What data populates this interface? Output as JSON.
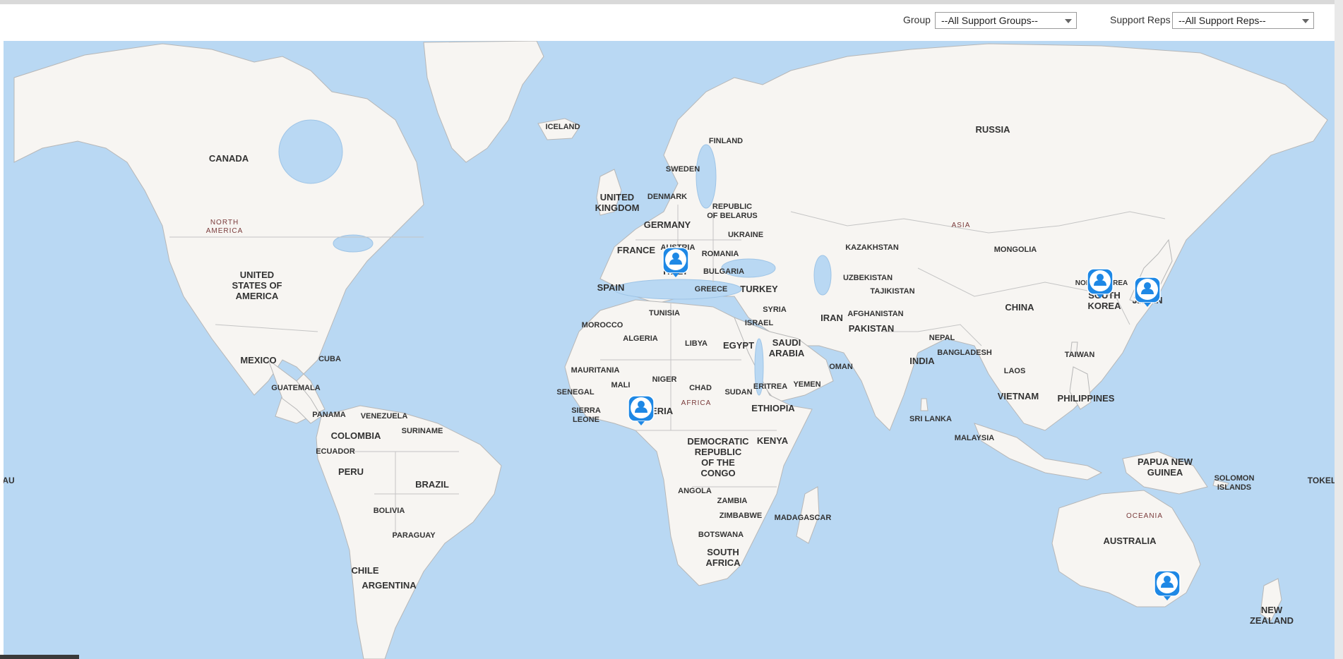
{
  "filters": {
    "group_label": "Group",
    "group_value": "--All Support Groups--",
    "reps_label": "Support Reps",
    "reps_value": "--All Support Reps--"
  },
  "map": {
    "ocean_color": "#b9d8f3",
    "land_color": "#f7f5f2",
    "border_color": "#b7b7b7",
    "marker_color": "#1e88e5",
    "marker_icon": "person-icon",
    "continent_labels": {
      "north_america": [
        "NORTH",
        "AMERICA"
      ],
      "africa": "AFRICA",
      "asia": "ASIA",
      "oceania": "OCEANIA"
    },
    "country_labels": {
      "canada": "CANADA",
      "usa": [
        "UNITED",
        "STATES OF",
        "AMERICA"
      ],
      "mexico": "MEXICO",
      "cuba": "CUBA",
      "guatemala": "GUATEMALA",
      "panama": "PANAMA",
      "venezuela": "VENEZUELA",
      "suriname": "SURINAME",
      "colombia": "COLOMBIA",
      "ecuador": "ECUADOR",
      "peru": "PERU",
      "brazil": "BRAZIL",
      "bolivia": "BOLIVIA",
      "paraguay": "PARAGUAY",
      "chile": "CHILE",
      "argentina": "ARGENTINA",
      "iceland": "ICELAND",
      "uk": [
        "UNITED",
        "KINGDOM"
      ],
      "sweden": "SWEDEN",
      "finland": "FINLAND",
      "denmark": "DENMARK",
      "belarus": [
        "REPUBLIC",
        "OF BELARUS"
      ],
      "germany": "GERMANY",
      "austria": "AUSTRIA",
      "ukraine": "UKRAINE",
      "france": "FRANCE",
      "romania": "ROMANIA",
      "bulgaria": "BULGARIA",
      "italy": "ITALY",
      "spain": "SPAIN",
      "greece": "GREECE",
      "turkey": "TURKEY",
      "tunisia": "TUNISIA",
      "syria": "SYRIA",
      "israel": "ISRAEL",
      "morocco": "MOROCCO",
      "algeria": "ALGERIA",
      "libya": "LIBYA",
      "egypt": "EGYPT",
      "saudi_arabia": [
        "SAUDI",
        "ARABIA"
      ],
      "mauritania": "MAURITANIA",
      "mali": "MALI",
      "niger": "NIGER",
      "chad": "CHAD",
      "sudan": "SUDAN",
      "eritrea": "ERITREA",
      "yemen": "YEMEN",
      "oman": "OMAN",
      "senegal": "SENEGAL",
      "sierra_leone": [
        "SIERRA",
        "LEONE"
      ],
      "nigeria": "NIGERIA",
      "ethiopia": "ETHIOPIA",
      "drc": [
        "DEMOCRATIC",
        "REPUBLIC",
        "OF THE",
        "CONGO"
      ],
      "kenya": "KENYA",
      "angola": "ANGOLA",
      "zambia": "ZAMBIA",
      "zimbabwe": "ZIMBABWE",
      "madagascar": "MADAGASCAR",
      "botswana": "BOTSWANA",
      "south_africa": [
        "SOUTH",
        "AFRICA"
      ],
      "russia": "RUSSIA",
      "kazakhstan": "KAZAKHSTAN",
      "mongolia": "MONGOLIA",
      "uzbekistan": "UZBEKISTAN",
      "tajikistan": "TAJIKISTAN",
      "afghanistan": "AFGHANISTAN",
      "iran": "IRAN",
      "pakistan": "PAKISTAN",
      "nepal": "NEPAL",
      "india": "INDIA",
      "bangladesh": "BANGLADESH",
      "china": "CHINA",
      "north_korea": "NORTH KOREA",
      "south_korea": [
        "SOUTH",
        "KOREA"
      ],
      "japan": "JAPAN",
      "taiwan": "TAIWAN",
      "laos": "LAOS",
      "vietnam": "VIETNAM",
      "philippines": "PHILIPPINES",
      "sri_lanka": "SRI LANKA",
      "malaysia": "MALAYSIA",
      "papua_new_guinea": [
        "PAPUA NEW",
        "GUINEA"
      ],
      "solomon_islands": [
        "SOLOMON",
        "ISLANDS"
      ],
      "australia": "AUSTRALIA",
      "new_zealand": [
        "NEW",
        "ZEALAND"
      ],
      "tokelau": "TOKEL",
      "left_edge": "AU"
    }
  }
}
